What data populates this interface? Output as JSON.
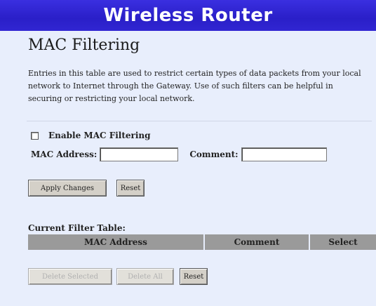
{
  "banner": {
    "title": "Wireless Router"
  },
  "page": {
    "title": "MAC Filtering",
    "description": "Entries in this table are used to restrict certain types of data packets from your local network to Internet through the Gateway. Use of such filters can be helpful in securing or restricting your local network."
  },
  "form": {
    "enable_label": "Enable MAC Filtering",
    "enable_checked": false,
    "mac_label": "MAC Address:",
    "mac_value": "",
    "comment_label": "Comment:",
    "comment_value": "",
    "apply_label": "Apply Changes",
    "reset_label": "Reset"
  },
  "table": {
    "title": "Current Filter Table:",
    "columns": [
      "MAC Address",
      "Comment",
      "Select"
    ],
    "rows": [],
    "delete_selected_label": "Delete Selected",
    "delete_all_label": "Delete All",
    "reset_label": "Reset"
  }
}
